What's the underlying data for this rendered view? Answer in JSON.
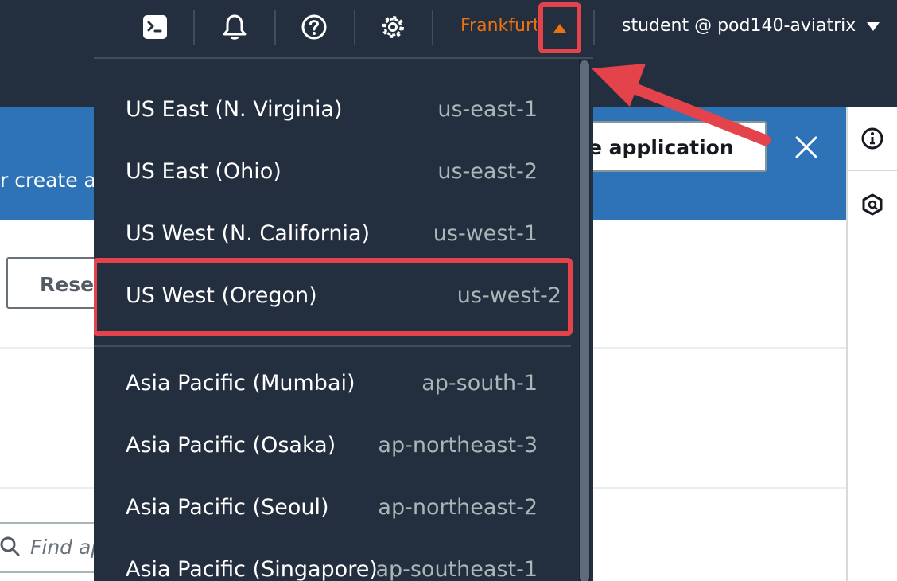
{
  "topnav": {
    "icons": [
      "cloudshell-icon",
      "bell-icon",
      "help-icon",
      "gear-icon"
    ],
    "region": "Frankfurt",
    "user": "student @ pod140-aviatrix"
  },
  "banner": {
    "text": "r create a",
    "button_label": "e application"
  },
  "content": {
    "reset_label": "Reset",
    "find_placeholder": "Find ap"
  },
  "regions": [
    {
      "name": "US East (N. Virginia)",
      "code": "us-east-1"
    },
    {
      "name": "US East (Ohio)",
      "code": "us-east-2"
    },
    {
      "name": "US West (N. California)",
      "code": "us-west-1"
    },
    {
      "name": "US West (Oregon)",
      "code": "us-west-2",
      "highlighted": true
    },
    {
      "name": "Asia Pacific (Mumbai)",
      "code": "ap-south-1"
    },
    {
      "name": "Asia Pacific (Osaka)",
      "code": "ap-northeast-3"
    },
    {
      "name": "Asia Pacific (Seoul)",
      "code": "ap-northeast-2"
    },
    {
      "name": "Asia Pacific (Singapore)",
      "code": "ap-southeast-1"
    }
  ],
  "colors": {
    "nav_bg": "#232f3e",
    "region_accent": "#ec7211",
    "banner_blue": "#2e73b8",
    "annotation_red": "#e5434b"
  }
}
